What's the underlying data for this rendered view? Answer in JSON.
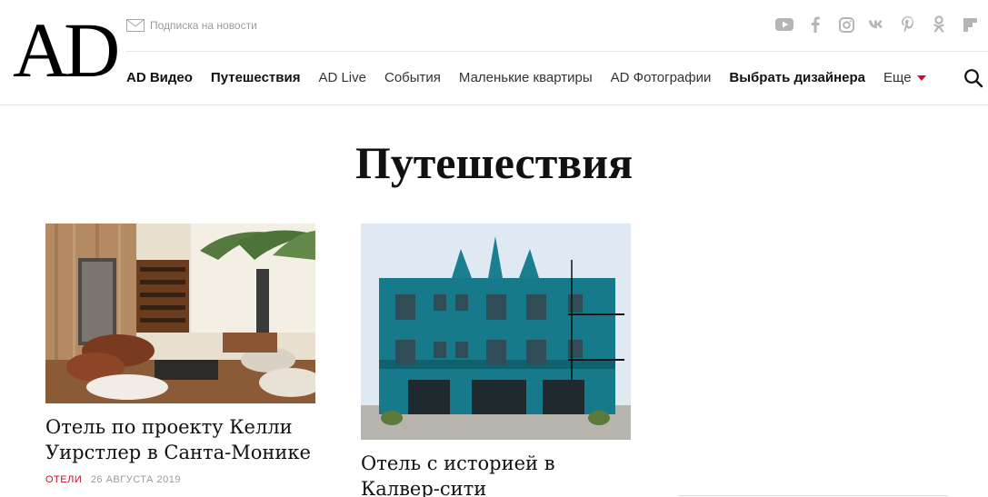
{
  "header": {
    "logo": "AD",
    "subscribe_label": "Подписка на новости",
    "social": [
      "youtube-icon",
      "facebook-icon",
      "instagram-icon",
      "vk-icon",
      "pinterest-icon",
      "odnoklassniki-icon",
      "flipboard-icon"
    ],
    "icon_color": "#b5b5b5",
    "accent_color": "#c8102e"
  },
  "nav": {
    "items": [
      {
        "label": "AD Видео"
      },
      {
        "label": "Путешествия"
      },
      {
        "label": "AD Live"
      },
      {
        "label": "События"
      },
      {
        "label": "Маленькие квартиры"
      },
      {
        "label": "AD Фотографии"
      },
      {
        "label": "Выбрать дизайнера"
      }
    ],
    "more_label": "Еще"
  },
  "page": {
    "title": "Путешествия"
  },
  "articles": [
    {
      "title": "Отель по проекту Келли Уирстлер в Санта-Монике",
      "category": "ОТЕЛИ",
      "date": "26 АВГУСТА 2019"
    },
    {
      "title": "Отель с историей в Калвер-сити"
    }
  ]
}
